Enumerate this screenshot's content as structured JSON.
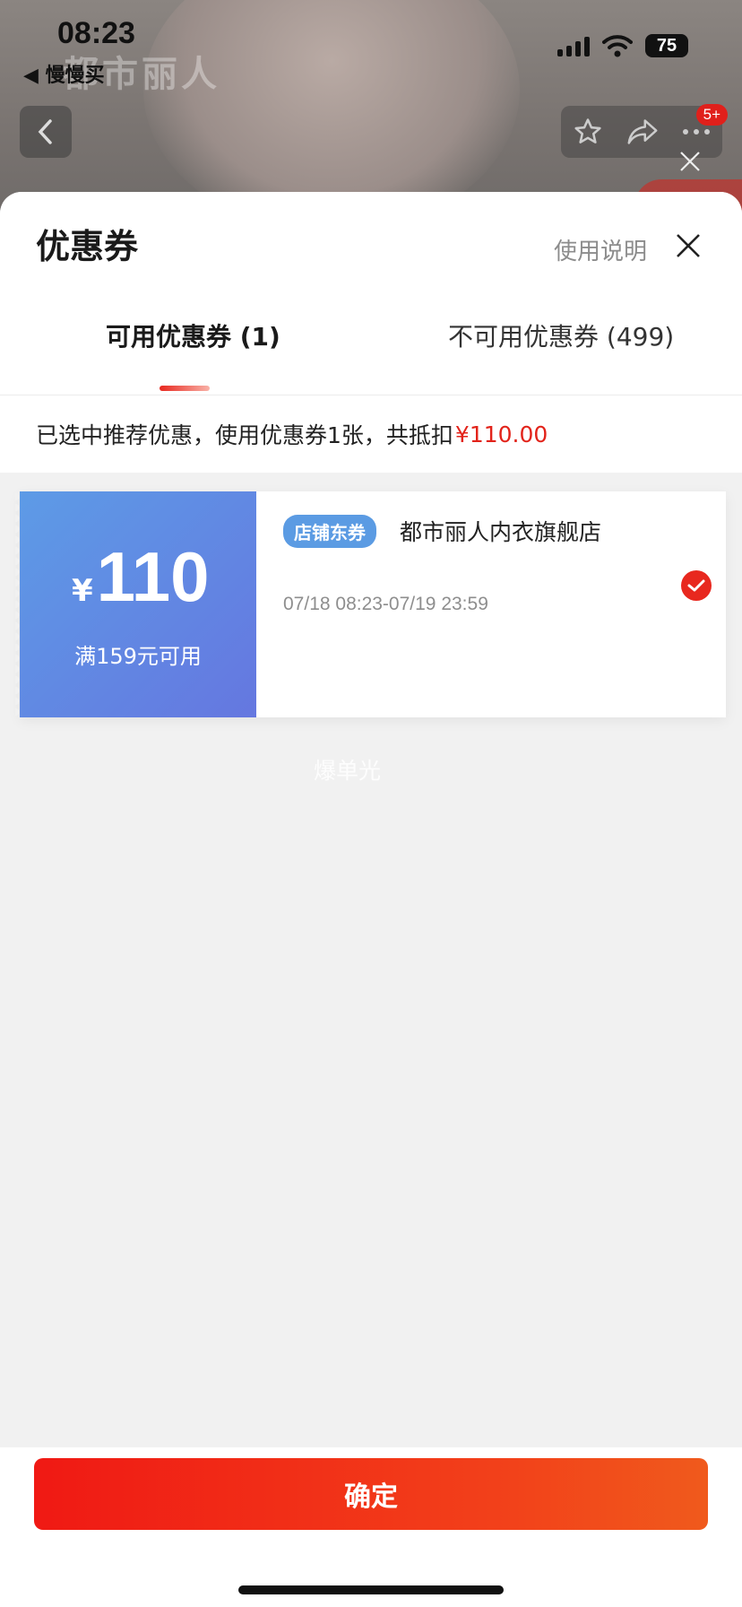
{
  "status_bar": {
    "time": "08:23",
    "back_app": "◀ 慢慢买",
    "battery": "75"
  },
  "background_page": {
    "shop_logo_text": "都市丽人",
    "cart_badge": "5+"
  },
  "sheet": {
    "title": "优惠券",
    "help_link": "使用说明",
    "tabs": [
      {
        "label": "可用优惠券 (1)",
        "active": true
      },
      {
        "label": "不可用优惠券 (499)",
        "active": false
      }
    ],
    "summary_text": "已选中推荐优惠，使用优惠券1张，共抵扣",
    "summary_amount": "¥110.00"
  },
  "coupon": {
    "currency": "¥",
    "value": "110",
    "condition": "满159元可用",
    "tag": "店铺东券",
    "shop_name": "都市丽人内衣旗舰店",
    "validity": "07/18 08:23-07/19 23:59",
    "selected": true
  },
  "watermark": "爆单光",
  "confirm_label": "确定",
  "colors": {
    "accent_red": "#e8281f",
    "coupon_blue_start": "#5d9be6",
    "coupon_blue_end": "#6577e0"
  }
}
